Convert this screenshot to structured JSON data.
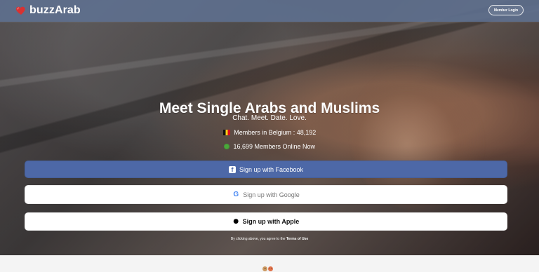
{
  "header": {
    "brand_name": "buzzArab",
    "member_login_label": "Member Login"
  },
  "hero": {
    "headline": "Meet Single Arabs and Muslims",
    "tagline": "Chat. Meet. Date. Love.",
    "country_members": "Members in Belgium : 48,192",
    "online_members": "16,699 Members Online Now",
    "buttons": {
      "facebook_label": "Sign up with Facebook",
      "google_label": "Sign up with Google",
      "apple_label": "Sign up with Apple"
    },
    "legal": {
      "prefix": "By clicking above, you agree to the",
      "link_label": "Terms of Use"
    }
  },
  "icons": {
    "brand": "heart-icon",
    "country_flag": "belgium-flag-icon",
    "online": "online-dot-icon",
    "facebook": "facebook-icon",
    "google": "google-icon",
    "apple": "apple-icon",
    "footer_people": [
      "man-icon",
      "woman-icon"
    ]
  },
  "colors": {
    "topbar": "#5e7191",
    "facebook": "#4d68a7",
    "button_white": "#ffffff",
    "online_green": "#4aa83a",
    "heart_red": "#d83232"
  }
}
